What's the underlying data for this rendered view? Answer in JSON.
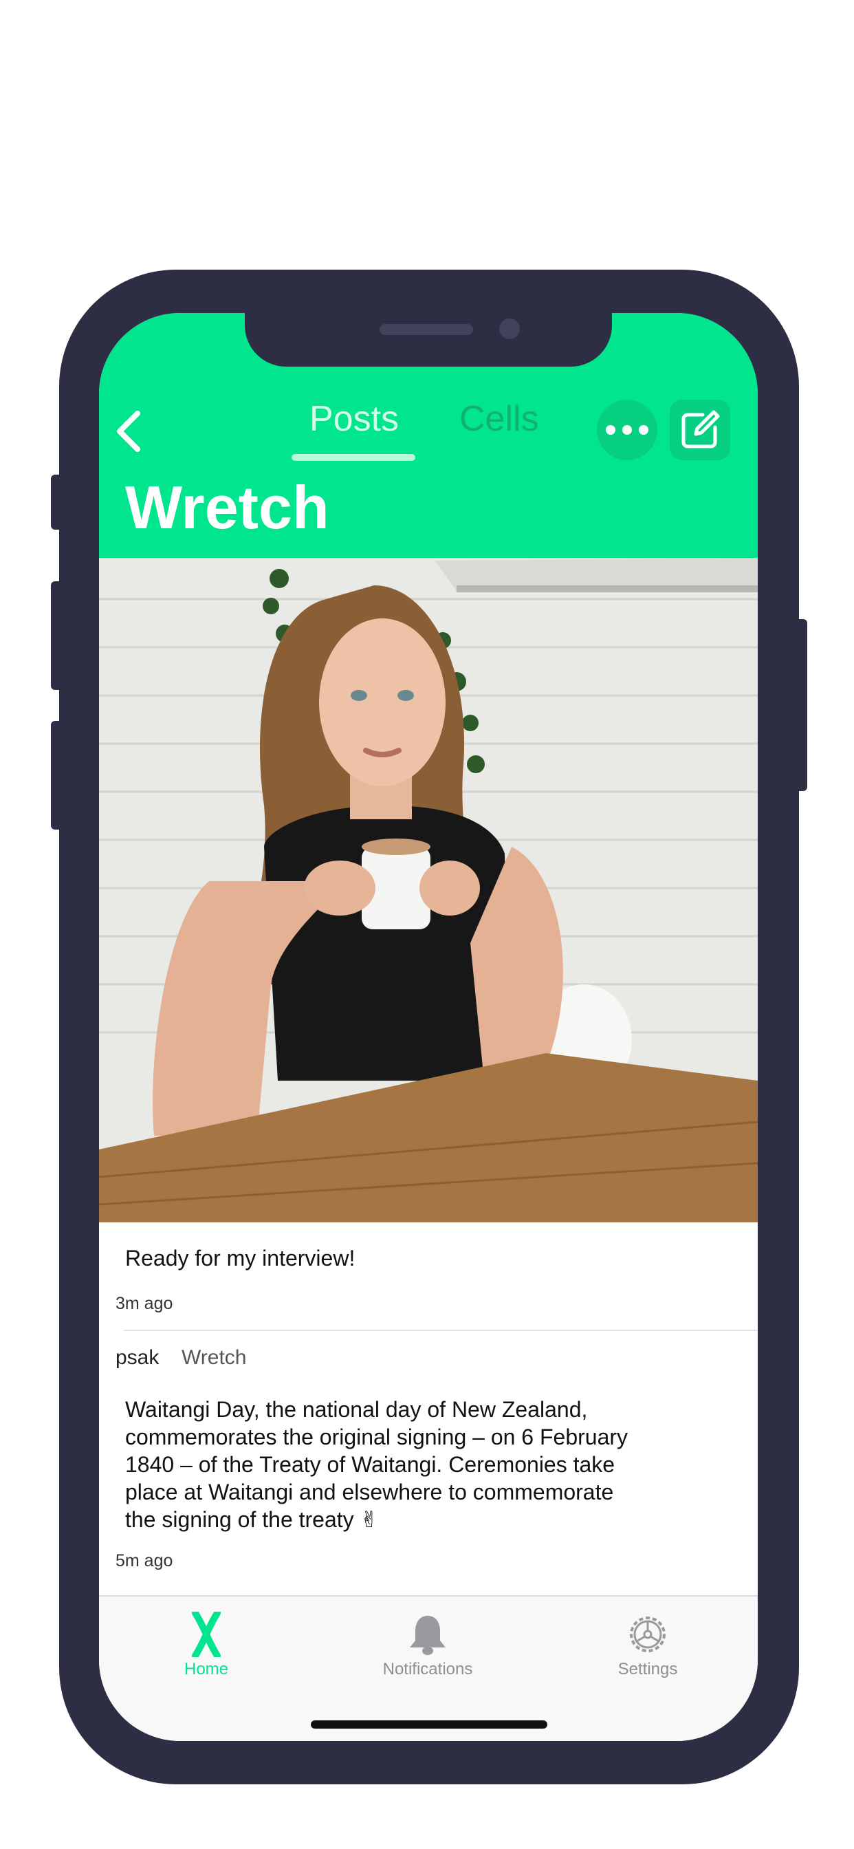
{
  "header": {
    "tabs": [
      {
        "label": "Posts",
        "active": true
      },
      {
        "label": "Cells",
        "active": false
      }
    ],
    "title": "Wretch",
    "back_icon": "chevron-left-icon",
    "more_icon": "ellipsis-icon",
    "compose_icon": "compose-icon"
  },
  "posts": [
    {
      "image": "photo of a woman holding a coffee cup at a wooden table",
      "text": "Ready for my interview!",
      "time": "3m ago"
    },
    {
      "author": "psak",
      "group": "Wretch",
      "text_lines": [
        "Waitangi Day, the national day of New Zealand,",
        "commemorates the original signing – on 6 February",
        "1840 – of the Treaty of Waitangi. Ceremonies take",
        "place at Waitangi and elsewhere to commemorate",
        "the signing of the treaty ✌"
      ],
      "time": "5m ago"
    }
  ],
  "tabbar": {
    "items": [
      {
        "label": "Home",
        "icon": "x-logo-icon",
        "active": true
      },
      {
        "label": "Notifications",
        "icon": "bell-icon",
        "active": false
      },
      {
        "label": "Settings",
        "icon": "gear-icon",
        "active": false
      }
    ]
  },
  "colors": {
    "accent": "#00e58e",
    "device_frame": "#2d2d43",
    "inactive_tab": "#8e8e93"
  }
}
